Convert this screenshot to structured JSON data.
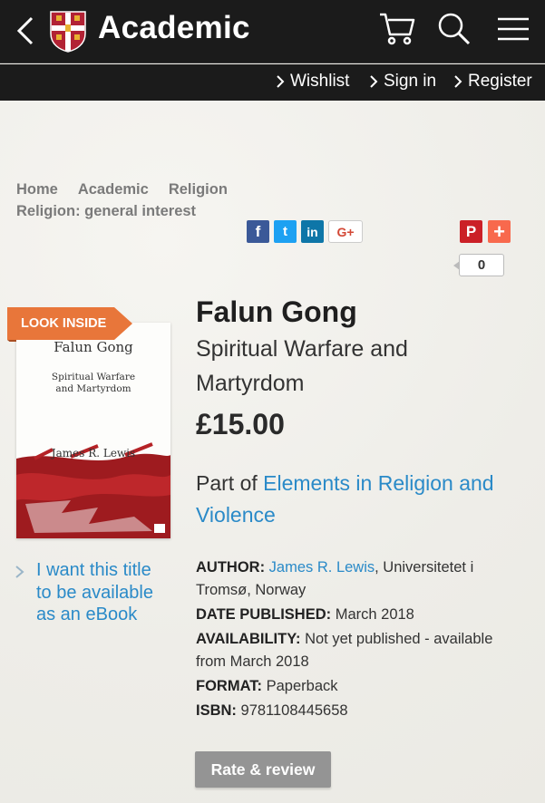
{
  "header": {
    "brand": "Academic",
    "icons": [
      "back-icon",
      "university-crest-icon",
      "cart-icon",
      "search-icon",
      "menu-icon"
    ]
  },
  "account": {
    "wishlist": "Wishlist",
    "sign_in": "Sign in",
    "register": "Register"
  },
  "breadcrumb": {
    "items": [
      "Home",
      "Academic",
      "Religion"
    ],
    "sub": "Religion: general interest"
  },
  "share": {
    "facebook": "f",
    "twitter": "t",
    "linkedin": "in",
    "gplus": "G+",
    "pinterest": "P",
    "more": "+",
    "count": "0"
  },
  "book": {
    "look_inside": "LOOK INSIDE",
    "cover_title": "Falun Gong",
    "cover_subtitle": "Spiritual Warfare and Martyrdom",
    "cover_author": "James R. Lewis",
    "title": "Falun Gong",
    "subtitle": "Spiritual Warfare and Martyrdom",
    "price": "£15.00",
    "series_prefix": "Part of ",
    "series_link": "Elements in Religion and Violence",
    "ebook_request": "I want this title to be available as an eBook",
    "author_label": "AUTHOR:",
    "author_name": "James R. Lewis",
    "author_affil": ", Universitetet i Tromsø, Norway",
    "date_label": "DATE PUBLISHED:",
    "date_value": "March 2018",
    "availability_label": "AVAILABILITY:",
    "availability_value": "Not yet published - available from March 2018",
    "format_label": "FORMAT:",
    "format_value": "Paperback",
    "isbn_label": "ISBN:",
    "isbn_value": "9781108445658",
    "rate_review": "Rate & review"
  },
  "colors": {
    "bar": "#1b1b1b",
    "link": "#2a8ac8",
    "badge": "#e8763a",
    "facebook": "#3b5998",
    "twitter": "#1da1f2",
    "linkedin": "#0e76a8",
    "pinterest": "#cb2027",
    "more": "#f8694d"
  }
}
